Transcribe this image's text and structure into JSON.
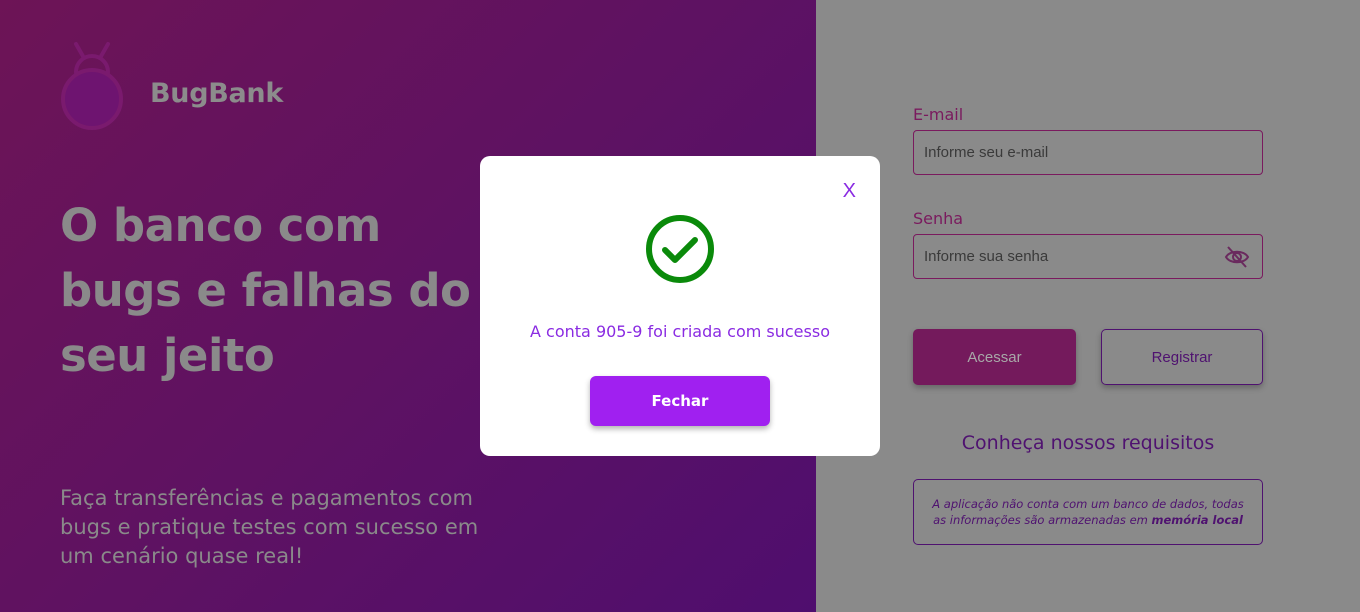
{
  "colors": {
    "hero_bg": "#5e1262",
    "login_bg": "#8a8a8a",
    "accent": "#8a2be2",
    "success": "#0a8a0a",
    "close_button": "#a020f0"
  },
  "brand": {
    "name": "BugBank",
    "logo_icon": "bug-logo-icon"
  },
  "hero": {
    "headline": "O banco com bugs e falhas do seu jeito",
    "subtext": "Faça transferências e pagamentos com bugs e pratique testes com sucesso em um cenário quase real!"
  },
  "login": {
    "email_label": "E-mail",
    "email_placeholder": "Informe seu e-mail",
    "password_label": "Senha",
    "password_placeholder": "Informe sua senha",
    "password_toggle_icon": "eye-off-icon",
    "access_button": "Acessar",
    "register_button": "Registrar",
    "requirements_title": "Conheça nossos requisitos",
    "requirements_text": "A aplicação não conta com um banco de dados, todas as informações são armazenadas em",
    "requirements_bold": "memória local"
  },
  "modal": {
    "close_label": "X",
    "icon": "check-circle-icon",
    "message": "A conta 905-9 foi criada com sucesso",
    "button": "Fechar"
  }
}
